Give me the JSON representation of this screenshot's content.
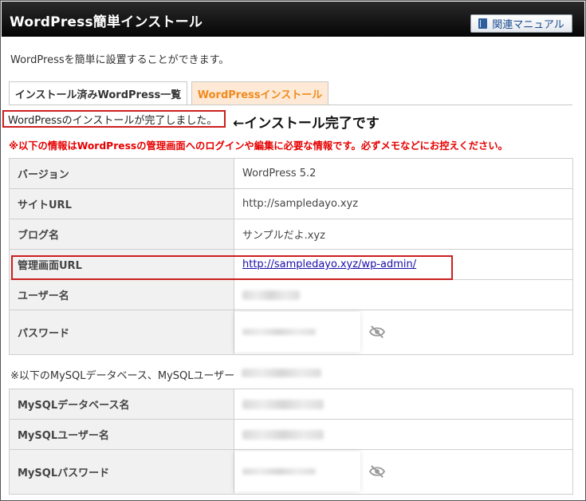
{
  "header": {
    "title": "WordPress簡単インストール",
    "manual_label": "関連マニュアル"
  },
  "description": "WordPressを簡単に設置することができます。",
  "tabs": [
    {
      "label": "インストール済みWordPress一覧",
      "active": false
    },
    {
      "label": "WordPressインストール",
      "active": true
    }
  ],
  "complete_message": "WordPressのインストールが完了しました。",
  "complete_annotation": "←インストール完了です",
  "warning": "※以下の情報はWordPressの管理画面へのログインや編集に必要な情報です。必ずメモなどにお控えください。",
  "wp_info": [
    {
      "label": "バージョン",
      "value": "WordPress 5.2"
    },
    {
      "label": "サイトURL",
      "value": "http://sampledayo.xyz"
    },
    {
      "label": "ブログ名",
      "value": "サンプルだよ.xyz"
    },
    {
      "label": "管理画面URL",
      "value": "http://sampledayo.xyz/wp-admin/"
    },
    {
      "label": "ユーザー名",
      "value": ""
    },
    {
      "label": "パスワード",
      "value": ""
    }
  ],
  "mysql_note": "※以下のMySQLデータベース、MySQLユーザー",
  "mysql_info": [
    {
      "label": "MySQLデータベース名",
      "value": ""
    },
    {
      "label": "MySQLユーザー名",
      "value": ""
    },
    {
      "label": "MySQLパスワード",
      "value": ""
    }
  ],
  "colors": {
    "accent": "#f08a1e",
    "alert": "#e60000",
    "highlight_border": "#cc1f1f",
    "header_bg": "#0a0a0a"
  },
  "icons": {
    "manual": "book-icon",
    "password_toggle": "eye-slash-icon"
  }
}
